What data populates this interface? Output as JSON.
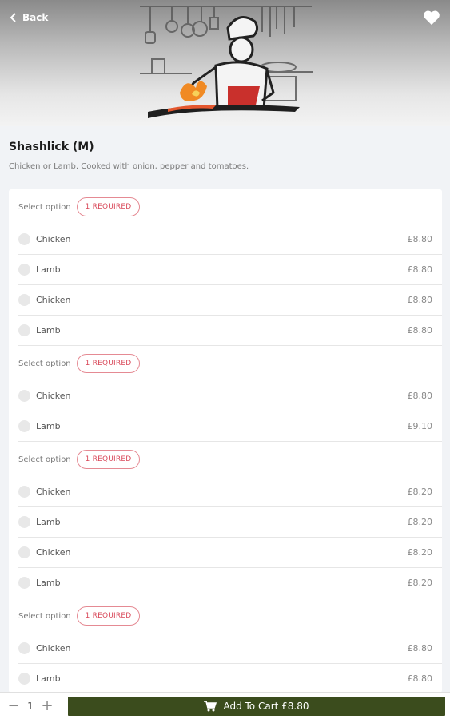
{
  "header": {
    "back_label": "Back",
    "back_icon": "chevron-left-icon",
    "favorite_icon": "heart-icon"
  },
  "item": {
    "title": "Shashlick (M)",
    "description": "Chicken or Lamb. Cooked with onion, pepper and tomatoes."
  },
  "groups": [
    {
      "label": "Select option",
      "badge": "1 REQUIRED",
      "options": [
        {
          "name": "Chicken",
          "price": "£8.80"
        },
        {
          "name": "Lamb",
          "price": "£8.80"
        },
        {
          "name": "Chicken",
          "price": "£8.80"
        },
        {
          "name": "Lamb",
          "price": "£8.80"
        }
      ]
    },
    {
      "label": "Select option",
      "badge": "1 REQUIRED",
      "options": [
        {
          "name": "Chicken",
          "price": "£8.80"
        },
        {
          "name": "Lamb",
          "price": "£9.10"
        }
      ]
    },
    {
      "label": "Select option",
      "badge": "1 REQUIRED",
      "options": [
        {
          "name": "Chicken",
          "price": "£8.20"
        },
        {
          "name": "Lamb",
          "price": "£8.20"
        },
        {
          "name": "Chicken",
          "price": "£8.20"
        },
        {
          "name": "Lamb",
          "price": "£8.20"
        }
      ]
    },
    {
      "label": "Select option",
      "badge": "1 REQUIRED",
      "options": [
        {
          "name": "Chicken",
          "price": "£8.80"
        },
        {
          "name": "Lamb",
          "price": "£8.80"
        }
      ]
    }
  ],
  "footer": {
    "minus": "−",
    "quantity": "1",
    "plus": "+",
    "cart_label": "Add To Cart £8.80",
    "cart_icon": "shopping-cart-icon"
  },
  "colors": {
    "cart_button": "#3b4c1d",
    "badge": "#d9495a"
  }
}
